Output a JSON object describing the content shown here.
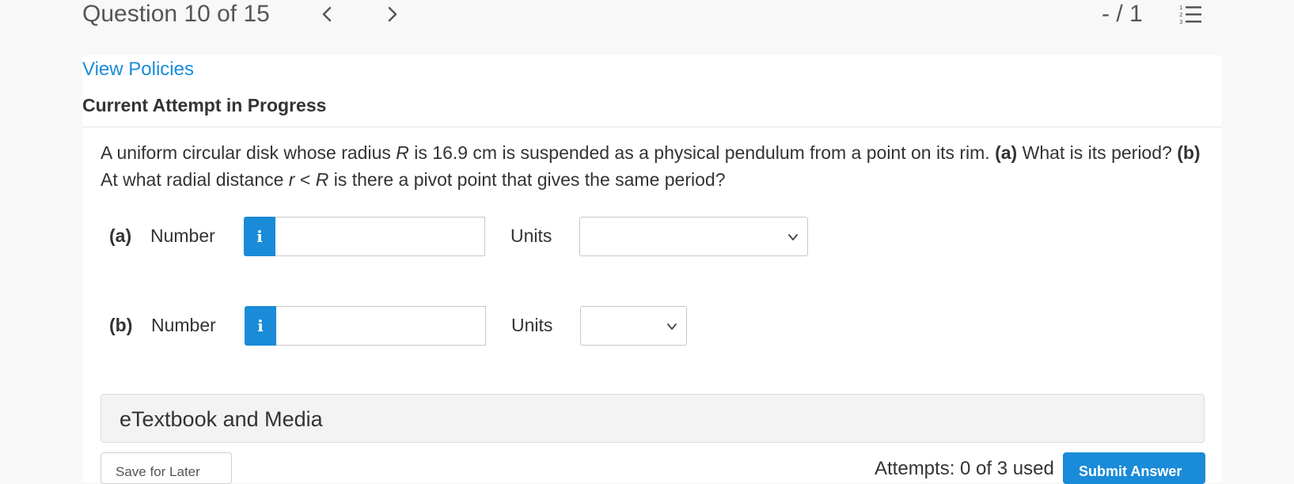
{
  "header": {
    "question_label": "Question 10 of 15",
    "score": "- / 1",
    "prev_icon": "chevron-left-icon",
    "next_icon": "chevron-right-icon",
    "list_icon": "numbered-list-icon"
  },
  "links": {
    "view_policies": "View Policies"
  },
  "attempt": {
    "heading": "Current Attempt in Progress"
  },
  "question": {
    "text_1": "A uniform circular disk whose radius ",
    "var_R": "R",
    "text_2": " is 16.9 cm is suspended as a physical pendulum from a point on its rim. ",
    "part_a": "(a)",
    "text_3": " What is its period? ",
    "part_b": "(b)",
    "text_4": " At what radial distance ",
    "var_r": "r",
    "text_5": " < ",
    "var_R2": "R",
    "text_6": " is there a pivot point that gives the same period?"
  },
  "answers": [
    {
      "label": "(a)",
      "number_label": "Number",
      "value": "",
      "units_label": "Units",
      "units_value": ""
    },
    {
      "label": "(b)",
      "number_label": "Number",
      "value": "",
      "units_label": "Units",
      "units_value": ""
    }
  ],
  "info_glyph": "i",
  "etextbook": {
    "label": "eTextbook and Media"
  },
  "footer": {
    "save_label": "Save for Later",
    "attempts_text": "Attempts: 0 of 3 used",
    "submit_label": "Submit Answer"
  },
  "colors": {
    "accent": "#1a8bd8",
    "background": "#f8f8f8",
    "panel": "#ffffff"
  }
}
